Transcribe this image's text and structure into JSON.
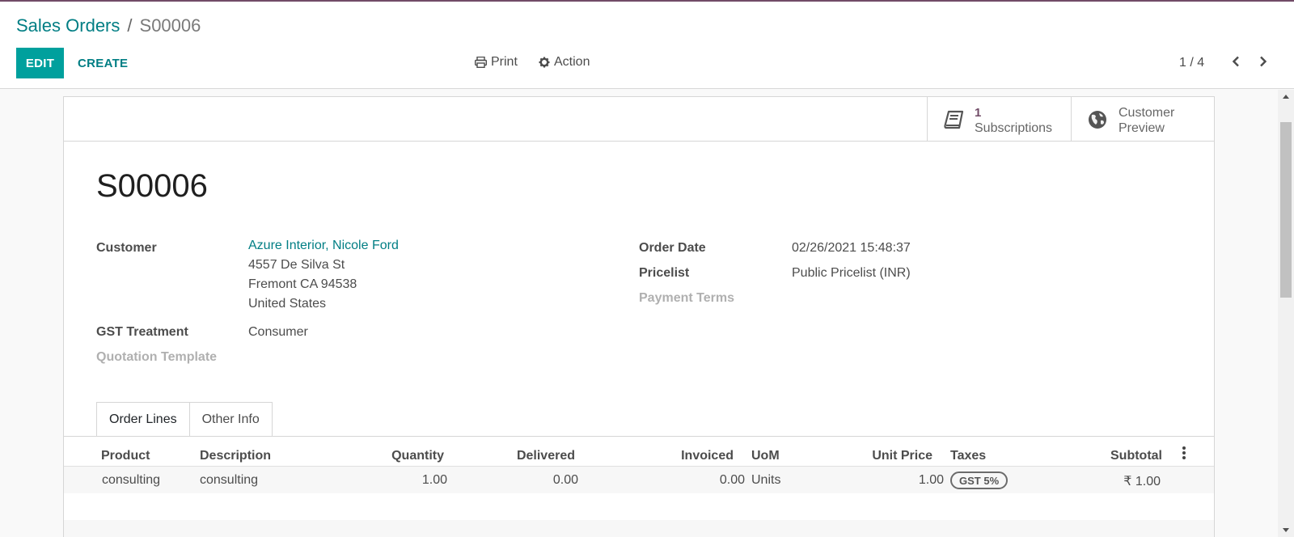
{
  "breadcrumb": {
    "parent": "Sales Orders",
    "separator": "/",
    "current": "S00006"
  },
  "buttons": {
    "edit": "EDIT",
    "create": "CREATE"
  },
  "toolbar": {
    "print": "Print",
    "action": "Action"
  },
  "pager": {
    "value": "1 / 4"
  },
  "stat_buttons": {
    "subscriptions": {
      "count": "1",
      "label": "Subscriptions",
      "icon": "book-icon"
    },
    "preview": {
      "line1": "Customer",
      "line2": "Preview",
      "icon": "globe-icon"
    }
  },
  "record": {
    "name": "S00006"
  },
  "fields": {
    "customer": {
      "label": "Customer",
      "name": "Azure Interior, Nicole Ford",
      "street": "4557 De Silva St",
      "city": "Fremont CA 94538",
      "country": "United States"
    },
    "gst_treatment": {
      "label": "GST Treatment",
      "value": "Consumer"
    },
    "quotation_template": {
      "label": "Quotation Template"
    },
    "order_date": {
      "label": "Order Date",
      "value": "02/26/2021 15:48:37"
    },
    "pricelist": {
      "label": "Pricelist",
      "value": "Public Pricelist (INR)"
    },
    "payment_terms": {
      "label": "Payment Terms"
    }
  },
  "tabs": [
    "Order Lines",
    "Other Info"
  ],
  "order_lines": {
    "columns": [
      "Product",
      "Description",
      "Quantity",
      "Delivered",
      "Invoiced",
      "UoM",
      "Unit Price",
      "Taxes",
      "Subtotal"
    ],
    "rows": [
      {
        "product": "consulting",
        "description": "consulting",
        "quantity": "1.00",
        "delivered": "0.00",
        "invoiced": "0.00",
        "uom": "Units",
        "unit_price": "1.00",
        "taxes": "GST 5%",
        "subtotal": "₹ 1.00"
      }
    ]
  },
  "colors": {
    "brand": "#714b67",
    "accent": "#00a09d",
    "link": "#017e84"
  }
}
